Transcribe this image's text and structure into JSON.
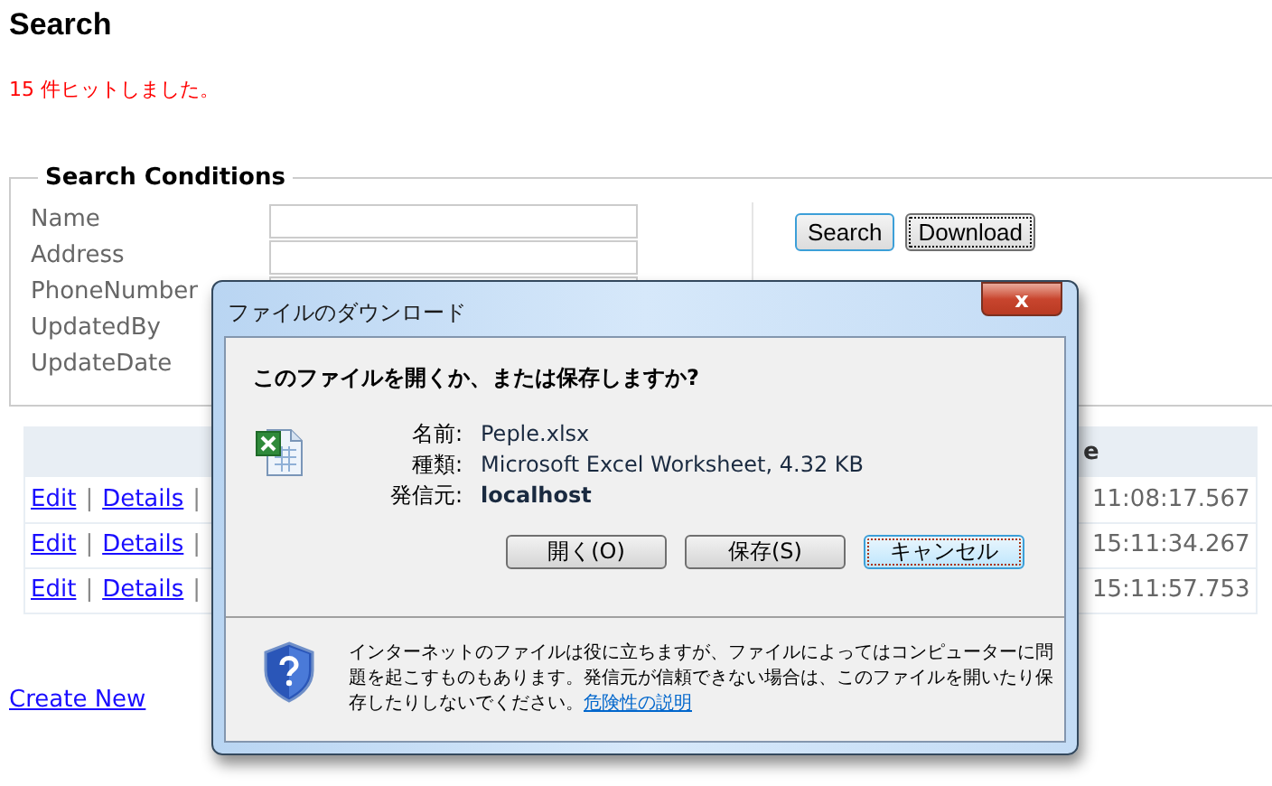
{
  "page": {
    "title": "Search",
    "hit_message": "15 件ヒットしました。",
    "create_link": "Create New"
  },
  "search_conditions": {
    "legend": "Search Conditions",
    "fields": [
      {
        "label": "Name",
        "kind": "input"
      },
      {
        "label": "Address",
        "kind": "input"
      },
      {
        "label": "PhoneNumber",
        "kind": "input"
      },
      {
        "label": "UpdatedBy",
        "kind": "label"
      },
      {
        "label": "UpdateDate",
        "kind": "label"
      }
    ],
    "buttons": [
      {
        "label": "Search",
        "focused": false,
        "kind": "default"
      },
      {
        "label": "Download",
        "focused": true,
        "kind": "normal"
      }
    ]
  },
  "table": {
    "columns": [
      {
        "kind": "actions"
      },
      {
        "kind": "text",
        "label": "e"
      }
    ],
    "rows": [
      {
        "links": [
          "Edit",
          "Details"
        ],
        "more_links": true,
        "column_2": "11:08:17.567"
      },
      {
        "links": [
          "Edit",
          "Details"
        ],
        "more_links": true,
        "column_2": "15:11:34.267"
      },
      {
        "links": [
          "Edit",
          "Details"
        ],
        "more_links": true,
        "column_2": "15:11:57.753"
      }
    ],
    "separator": "|"
  },
  "dialog": {
    "title": "ファイルのダウンロード",
    "close": "x",
    "question": "このファイルを開くか、または保存しますか?",
    "details": [
      {
        "label": "名前:",
        "value": "Peple.xlsx",
        "bold": false
      },
      {
        "label": "種類:",
        "value": "Microsoft Excel Worksheet, 4.32 KB",
        "bold": false
      },
      {
        "label": "発信元:",
        "value": "localhost",
        "bold": true
      }
    ],
    "buttons": [
      {
        "label": "開く(O)",
        "focused": false
      },
      {
        "label": "保存(S)",
        "focused": false
      },
      {
        "label": "キャンセル",
        "focused": true
      }
    ],
    "warning": "インターネットのファイルは役に立ちますが、ファイルによってはコンピューターに問題を起こすものもあります。発信元が信頼できない場合は、このファイルを開いたり保存したりしないでください。",
    "warning_link": "危険性の説明"
  }
}
